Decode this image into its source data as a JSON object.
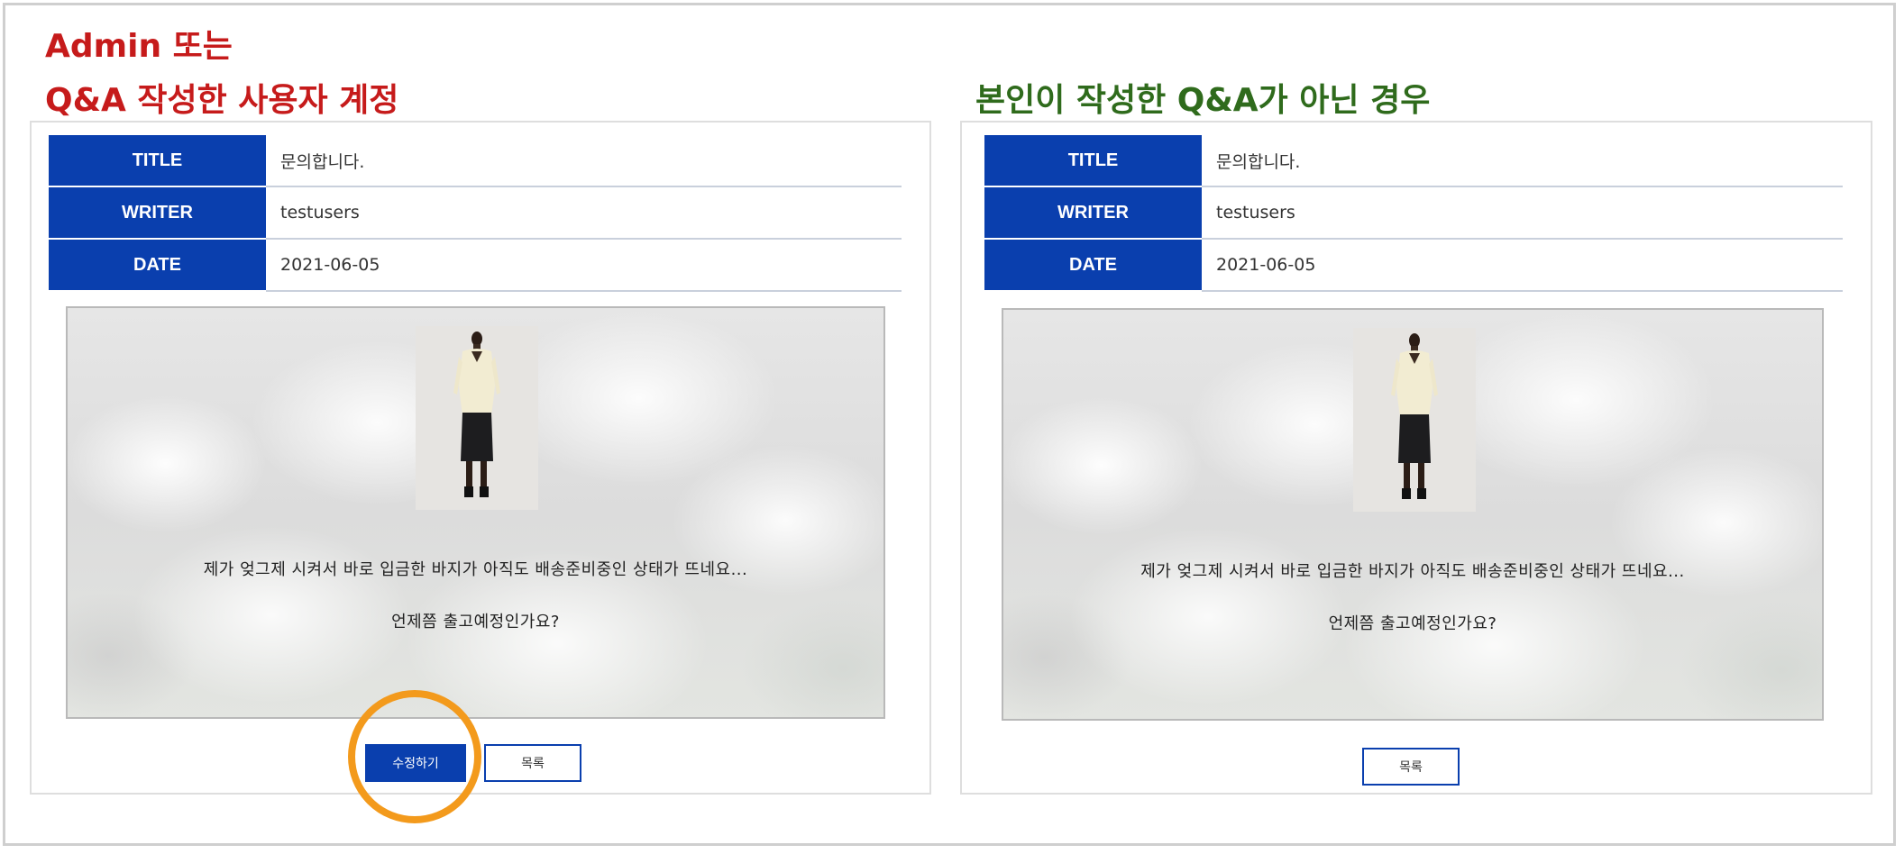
{
  "headings": {
    "left_line1": "Admin 또는",
    "left_line2": "Q&A 작성한 사용자 계정",
    "right": "본인이 작성한 Q&A가 아닌 경우"
  },
  "colors": {
    "heading_left": "#c61b1b",
    "heading_right": "#2f6b1c",
    "header_cell_bg": "#0a3fae",
    "highlight_ring": "#f39a1c"
  },
  "left_panel": {
    "fields": [
      {
        "label": "TITLE",
        "value": "문의합니다."
      },
      {
        "label": "WRITER",
        "value": "testusers"
      },
      {
        "label": "DATE",
        "value": "2021-06-05"
      }
    ],
    "message_line1": "제가 엊그제 시켜서 바로 입금한 바지가 아직도 배송준비중인 상태가 뜨네요...",
    "message_line2": "언제쯤 출고예정인가요?",
    "edit_button": "수정하기",
    "list_button": "목록"
  },
  "right_panel": {
    "fields": [
      {
        "label": "TITLE",
        "value": "문의합니다."
      },
      {
        "label": "WRITER",
        "value": "testusers"
      },
      {
        "label": "DATE",
        "value": "2021-06-05"
      }
    ],
    "message_line1": "제가 엊그제 시켜서 바로 입금한 바지가 아직도 배송준비중인 상태가 뜨네요...",
    "message_line2": "언제쯤 출고예정인가요?",
    "list_button": "목록"
  }
}
